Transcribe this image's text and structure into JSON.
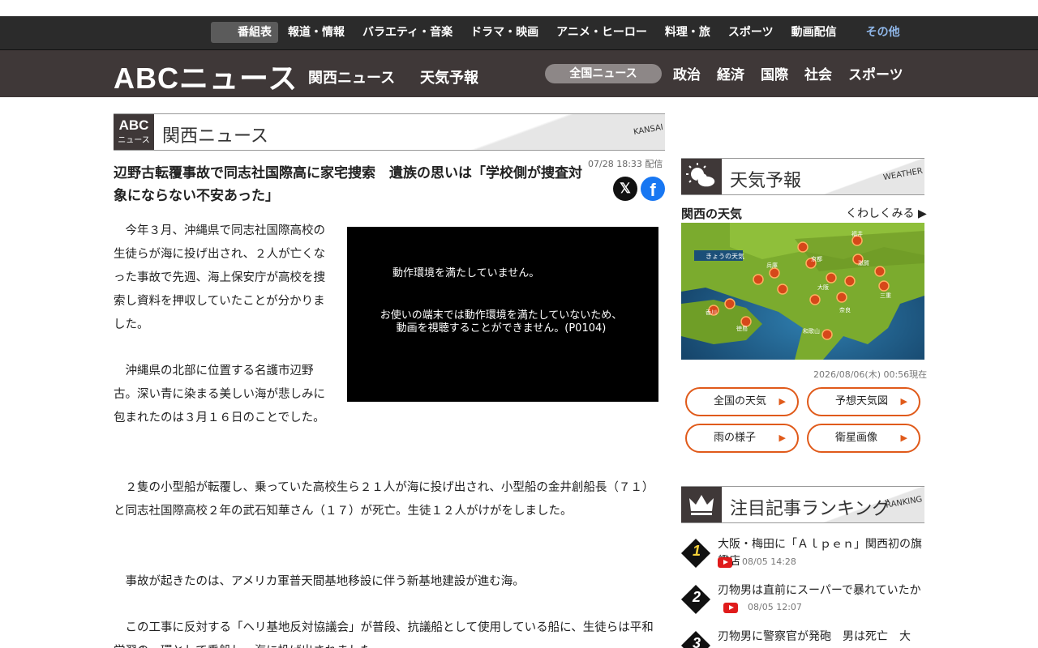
{
  "topnav": {
    "items": [
      "番組表",
      "報道・情報",
      "バラエティ・音楽",
      "ドラマ・映画",
      "アニメ・ヒーロー",
      "料理・旅",
      "スポーツ",
      "動画配信",
      "その他"
    ]
  },
  "brand": {
    "logo": "ABCニュース",
    "links": [
      "関西ニュース",
      "天気予報"
    ],
    "categories": [
      "全国ニュース",
      "政治",
      "経済",
      "国際",
      "社会",
      "スポーツ"
    ]
  },
  "section": {
    "badge_top": "ABC",
    "badge_bottom": "ニュース",
    "title": "関西ニュース",
    "en": "KANSAI"
  },
  "article": {
    "headline": "辺野古転覆事故で同志社国際高に家宅捜索　遺族の思いは「学校側が捜査対象にならない不安あった」",
    "date": "07/28 18:33 配信",
    "share_x": "𝕏",
    "share_fb": "f",
    "paragraphs": [
      "　今年３月、沖縄県で同志社国際高校の生徒らが海に投げ出され、２人が亡くなった事故で先週、海上保安庁が高校を捜索し資料を押収していたことが分かりました。",
      "　沖縄県の北部に位置する名護市辺野古。深い青に染まる美しい海が悲しみに包まれたのは３月１６日のことでした。",
      "　２隻の小型船が転覆し、乗っていた高校生ら２１人が海に投げ出され、小型船の金井創船長（７１）と同志社国際高校２年の武石知華さん（１７）が死亡。生徒１２人がけがをしました。",
      "　事故が起きたのは、アメリカ軍普天間基地移設に伴う新基地建設が進む海。",
      "　この工事に反対する「ヘリ基地反対協議会」が普段、抗議船として使用している船に、生徒らは平和学習の一環として乗船し、海に投げ出されました。"
    ]
  },
  "video": {
    "line1": "動作環境を満たしていません。",
    "line2": "お使いの端末では動作環境を満たしていないため、",
    "line3": "動画を視聴することができません。(P0104)"
  },
  "weather": {
    "title": "天気予報",
    "en": "WEATHER",
    "region": "関西の天気",
    "more": "くわしくみる ▶",
    "map_label": "きょうの天気",
    "cities": [
      "福井",
      "京都",
      "滋賀",
      "兵庫",
      "大阪",
      "三重",
      "奈良",
      "香川",
      "徳島",
      "和歌山"
    ],
    "timestamp": "2026/08/06(木) 00:56現在",
    "buttons": [
      "全国の天気",
      "予想天気図",
      "雨の様子",
      "衛星画像"
    ],
    "accent": "#e05a1a"
  },
  "ranking": {
    "title": "注目記事ランキング",
    "en": "RANKING",
    "items": [
      {
        "rank": "1",
        "title": "大阪・梅田に「Ａｌｐｅｎ」関西初の旗艦店",
        "date": "08/05 14:28"
      },
      {
        "rank": "2",
        "title": "刃物男は直前にスーパーで暴れていたか",
        "date": "08/05 12:07"
      },
      {
        "rank": "3",
        "title": "刃物男に警察官が発砲　男は死亡　大",
        "date": ""
      }
    ]
  }
}
